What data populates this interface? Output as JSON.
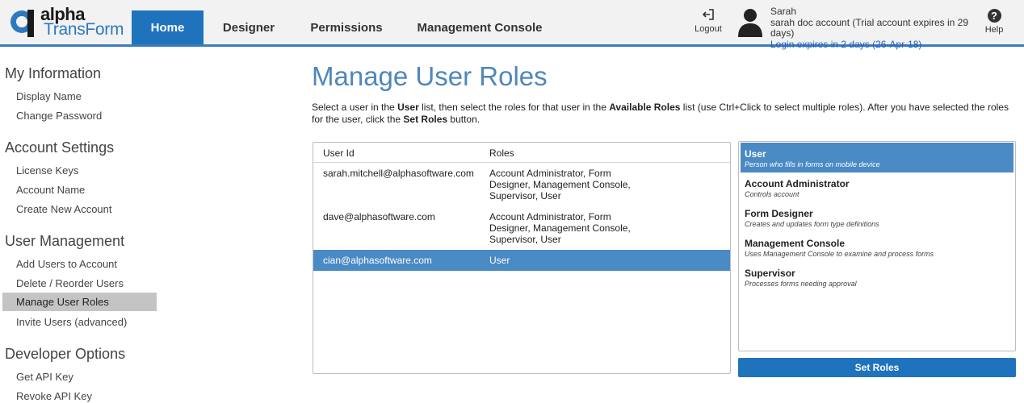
{
  "brand": {
    "alpha": "alpha",
    "transform": "TransForm",
    "accent": "#1f73bd",
    "title_color": "#4e87bd"
  },
  "nav": {
    "tabs": [
      {
        "label": "Home",
        "active": true
      },
      {
        "label": "Designer",
        "active": false
      },
      {
        "label": "Permissions",
        "active": false
      },
      {
        "label": "Management Console",
        "active": false
      }
    ]
  },
  "header": {
    "logout_label": "Logout",
    "user_name": "Sarah",
    "account_line": "sarah doc account (Trial account expires in 29 days)",
    "login_expiry": "Login expires in 2 days (26-Apr-18)",
    "help_label": "Help",
    "help_glyph": "?"
  },
  "sidebar": {
    "sections": [
      {
        "heading": "My Information",
        "items": [
          "Display Name",
          "Change Password"
        ]
      },
      {
        "heading": "Account Settings",
        "items": [
          "License Keys",
          "Account Name",
          "Create New Account"
        ]
      },
      {
        "heading": "User Management",
        "items": [
          "Add Users to Account",
          "Delete / Reorder Users",
          "Manage User Roles",
          "Invite Users (advanced)"
        ]
      },
      {
        "heading": "Developer Options",
        "items": [
          "Get API Key",
          "Revoke API Key"
        ]
      }
    ],
    "active_item": "Manage User Roles"
  },
  "main": {
    "title": "Manage User Roles",
    "instructions": {
      "p1": "Select a user in the ",
      "b1": "User",
      "p2": " list, then select the roles for that user in the ",
      "b2": "Available Roles",
      "p3": " list (use Ctrl+Click to select multiple roles). After you have selected the roles for the user, click the ",
      "b3": "Set Roles",
      "p4": " button."
    },
    "table": {
      "headers": {
        "user_id": "User Id",
        "roles": "Roles"
      },
      "rows": [
        {
          "user": "sarah.mitchell@alphasoftware.com",
          "roles": "Account Administrator, Form Designer, Management Console, Supervisor, User",
          "selected": false
        },
        {
          "user": "dave@alphasoftware.com",
          "roles": "Account Administrator, Form Designer, Management Console, Supervisor, User",
          "selected": false
        },
        {
          "user": "cian@alphasoftware.com",
          "roles": "User",
          "selected": true
        }
      ]
    },
    "roles": [
      {
        "name": "User",
        "description": "Person who fills in forms on mobile device",
        "selected": true
      },
      {
        "name": "Account Administrator",
        "description": "Controls account",
        "selected": false
      },
      {
        "name": "Form Designer",
        "description": "Creates and updates form type definitions",
        "selected": false
      },
      {
        "name": "Management Console",
        "description": "Uses Management Console to examine and process forms",
        "selected": false
      },
      {
        "name": "Supervisor",
        "description": "Processes forms needing approval",
        "selected": false
      }
    ],
    "set_roles_label": "Set Roles"
  }
}
